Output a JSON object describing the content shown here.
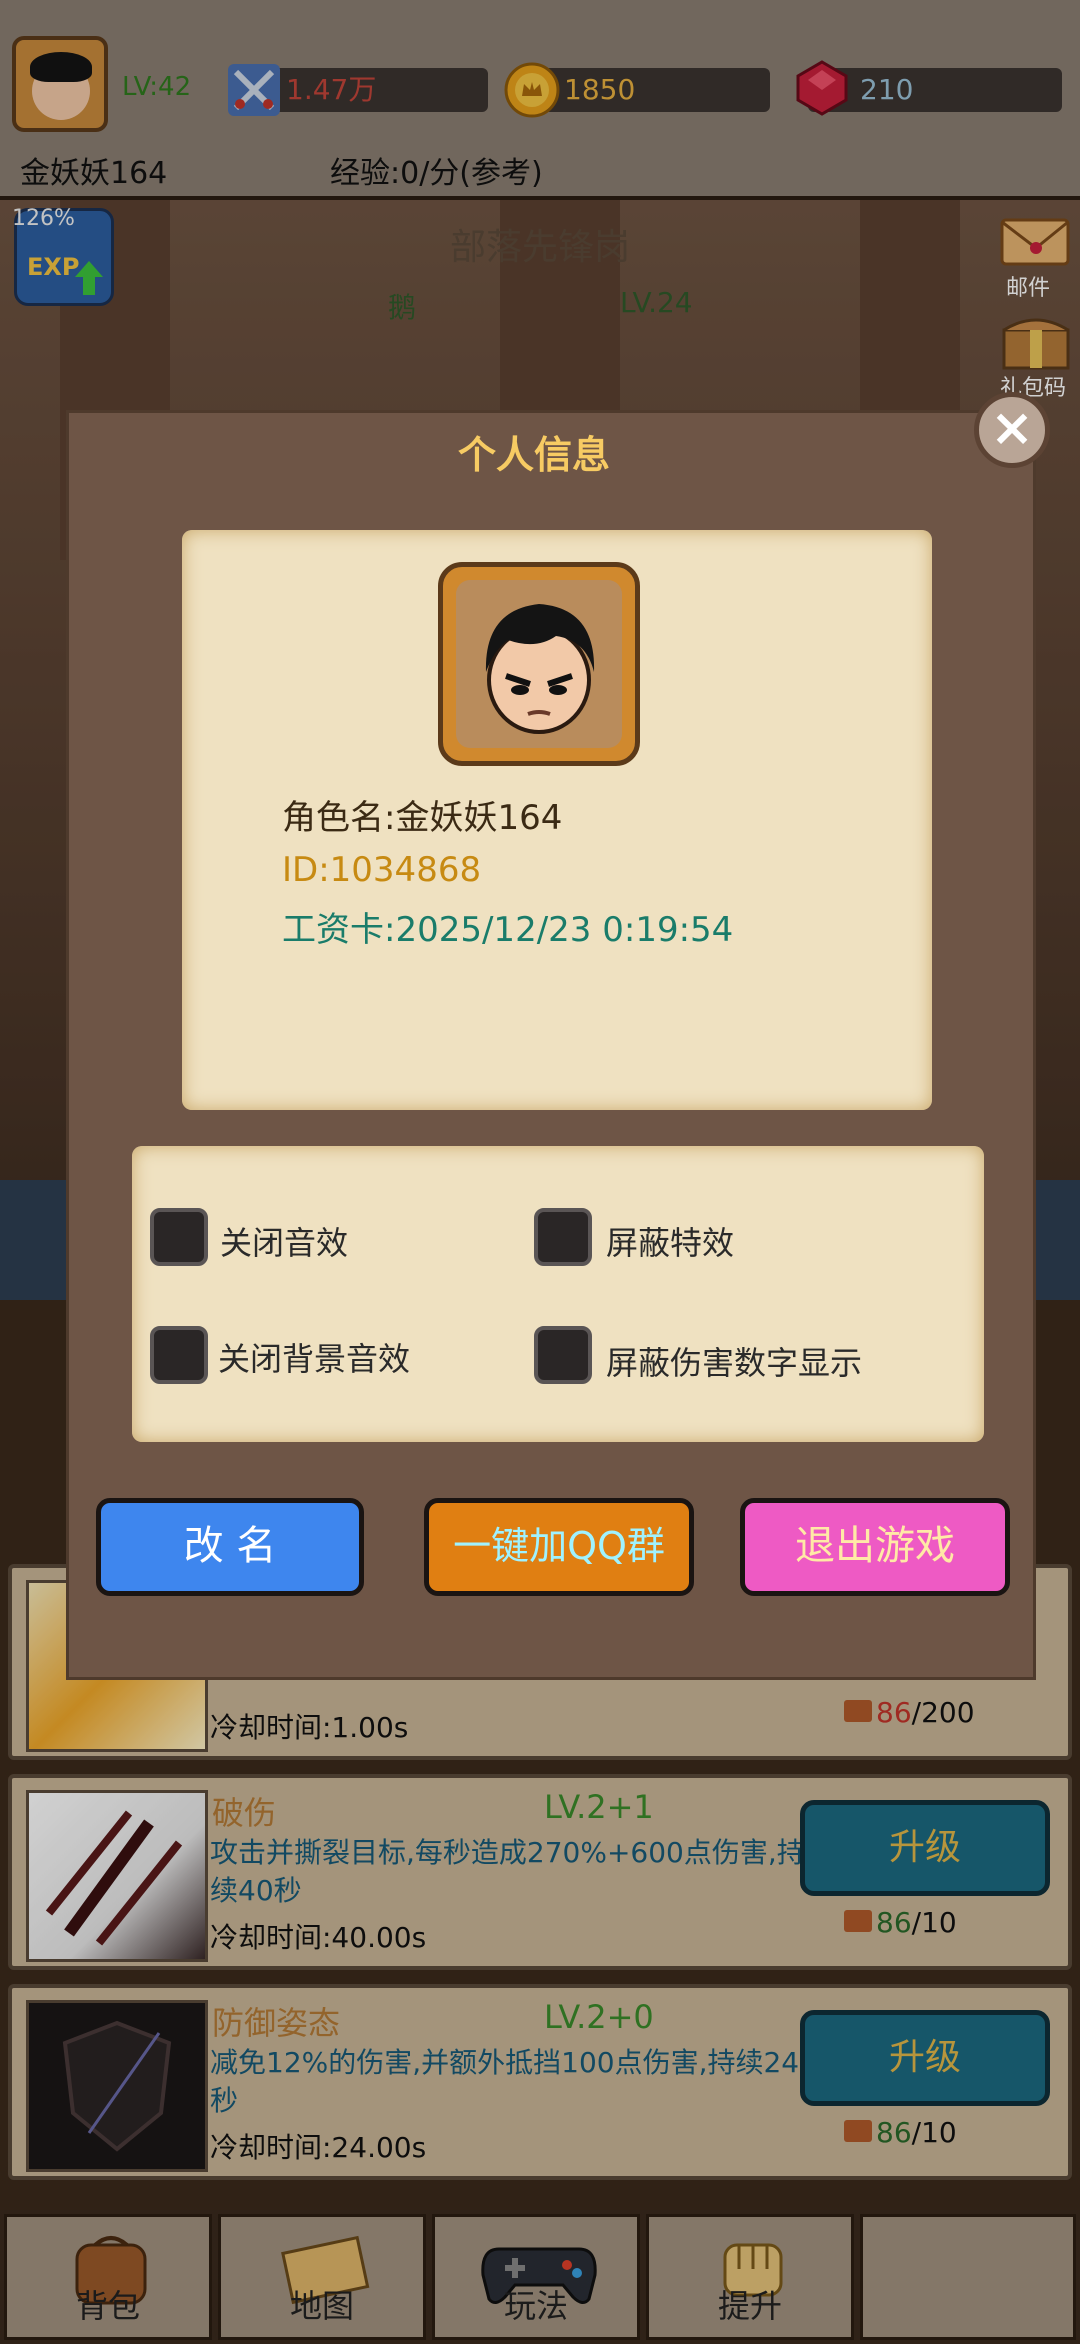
{
  "topbar": {
    "level": "LV:42",
    "power": "1.47万",
    "gold": "1850",
    "gems": "210",
    "player_name": "金妖妖164",
    "exp_rate": "经验:0/分(参考)"
  },
  "scene": {
    "area_title": "部落先锋岗",
    "enemy_name": "鹅",
    "enemy_level": "LV.24",
    "exp_boost": "126%",
    "exp_badge_label": "EXP",
    "side_icons": [
      {
        "label": "邮件",
        "icon": "mail-icon"
      },
      {
        "label": "礼包码",
        "icon": "gift-chest-icon"
      }
    ]
  },
  "modal": {
    "title": "个人信息",
    "role_name": "角色名:金妖妖164",
    "id": "ID:1034868",
    "salary_card": "工资卡:2025/12/23 0:19:54",
    "options": [
      {
        "label": "关闭音效",
        "checked": false
      },
      {
        "label": "屏蔽特效",
        "checked": false
      },
      {
        "label": "关闭背景音效",
        "checked": false
      },
      {
        "label": "屏蔽伤害数字显示",
        "checked": false
      }
    ],
    "buttons": {
      "rename": "改 名",
      "join_qq": "一键加QQ群",
      "exit": "退出游戏"
    }
  },
  "skills": [
    {
      "name": "",
      "level": "",
      "desc": "",
      "cooldown": "冷却时间:1.00s",
      "cost_have": "86",
      "cost_need": "/200",
      "button": ""
    },
    {
      "name": "破伤",
      "level": "LV.2+1",
      "desc": "攻击并撕裂目标,每秒造成270%+600点伤害,持续40秒",
      "cooldown": "冷却时间:40.00s",
      "cost_have": "86",
      "cost_need": "/10",
      "button": "升级"
    },
    {
      "name": "防御姿态",
      "level": "LV.2+0",
      "desc": "减免12%的伤害,并额外抵挡100点伤害,持续24秒",
      "cooldown": "冷却时间:24.00s",
      "cost_have": "86",
      "cost_need": "/10",
      "button": "升级"
    }
  ],
  "nav": [
    {
      "label": "背包",
      "icon": "backpack-icon"
    },
    {
      "label": "地图",
      "icon": "map-scroll-icon"
    },
    {
      "label": "玩法",
      "icon": "gamepad-icon"
    },
    {
      "label": "提升",
      "icon": "fist-icon"
    },
    {
      "label": "",
      "icon": ""
    }
  ],
  "colors": {
    "gold_text": "#f7cb63",
    "rename_button": "#3e86ee",
    "qq_button": "#e07f12",
    "exit_button": "#ee5ac4",
    "upgrade_button": "#1b6a80"
  }
}
